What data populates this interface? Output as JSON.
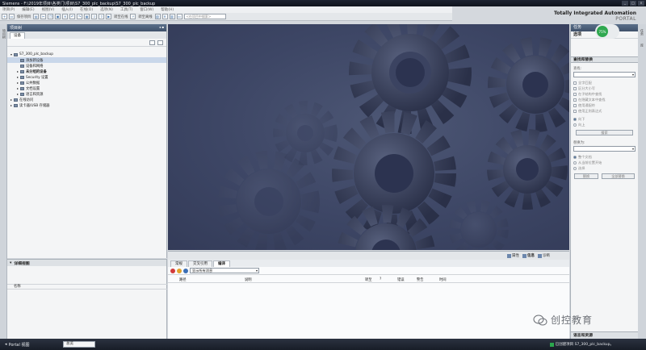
{
  "window": {
    "title": "Siemens - F:\\2019年项目\\各类门\\项目\\S7_300_plc_backup\\S7_300_plc_backup",
    "controls": [
      "_",
      "□",
      "×"
    ]
  },
  "menu": [
    "项目(P)",
    "编辑(E)",
    "视图(V)",
    "插入(I)",
    "在线(O)",
    "选项(N)",
    "工具(T)",
    "窗口(W)",
    "帮助(H)"
  ],
  "toolbar": {
    "save_project": "保存项目",
    "go_online": "转至在线",
    "go_offline": "转至离线",
    "search_placeholder": "<在项目中搜索>"
  },
  "brand": {
    "line1": "Totally Integrated Automation",
    "line2": "PORTAL"
  },
  "left_strip_label": "项目树",
  "project_tree": {
    "header": "项目树",
    "tab": "设备",
    "items": [
      {
        "label": "S7_300_plc_backup",
        "level": 0,
        "arrow": "▾"
      },
      {
        "label": "添加新设备",
        "level": 1,
        "arrow": ""
      },
      {
        "label": "设备和网络",
        "level": 1,
        "arrow": ""
      },
      {
        "label": "未分组的设备",
        "level": 1,
        "arrow": "▸"
      },
      {
        "label": "Security 设置",
        "level": 1,
        "arrow": "▸"
      },
      {
        "label": "公共数据",
        "level": 1,
        "arrow": "▸"
      },
      {
        "label": "文档设置",
        "level": 1,
        "arrow": "▸"
      },
      {
        "label": "语言和资源",
        "level": 1,
        "arrow": "▸"
      },
      {
        "label": "在线访问",
        "level": 0,
        "arrow": "▸"
      },
      {
        "label": "读卡器/USB 存储器",
        "level": 0,
        "arrow": "▸"
      }
    ]
  },
  "details": {
    "header": "详细视图",
    "name_column": "名称"
  },
  "bottom_panel": {
    "inspector_tabs": [
      "属性",
      "信息",
      "诊断"
    ],
    "tabs": [
      "常规",
      "交叉引用",
      "编译"
    ],
    "active_tab": "编译",
    "filter": "显示所有消息",
    "columns": [
      "路径",
      "说明",
      "转至",
      "?",
      "错误",
      "警告",
      "时间"
    ]
  },
  "tasks": {
    "header": "任务",
    "sub": "选项",
    "find_replace": "查找和替换",
    "find_label": "查找:",
    "checkboxes": [
      "全字匹配",
      "区分大小写",
      "在子结构中查找",
      "在隐藏文本中查找",
      "使用通配符",
      "使用正则表达式"
    ],
    "direction_radios": [
      "向下",
      "向上"
    ],
    "search_button": "搜索",
    "replace_label": "替换为:",
    "scope_radios": [
      "整个文档",
      "从当前位置开始",
      "选择"
    ],
    "replace_button": "替换",
    "replace_all_button": "全部替换",
    "languages_resources": "语言和资源",
    "badge": "75%"
  },
  "right_strip_labels": [
    "任务",
    "库"
  ],
  "statusbar": {
    "portal": "Portal 视图",
    "overview": "总览",
    "message": "已创建项目 S7_300_plc_backup。"
  },
  "watermark": "创控教育"
}
